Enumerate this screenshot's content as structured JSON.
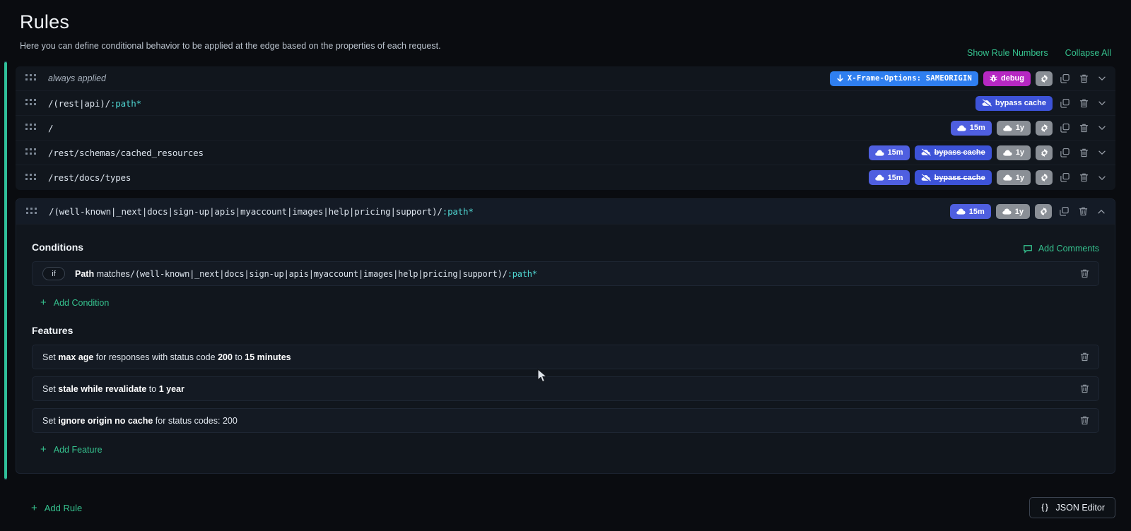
{
  "header": {
    "title": "Rules",
    "subtitle": "Here you can define conditional behavior to be applied at the edge based on the properties of each request."
  },
  "toolbar": {
    "show_rule_numbers": "Show Rule Numbers",
    "collapse_all": "Collapse All"
  },
  "rules": [
    {
      "path_prefix": "always applied",
      "path_suffix": "",
      "is_always": true,
      "badges": [
        {
          "label": "X-Frame-Options: SAMEORIGIN",
          "color": "blue",
          "icon": "arrow-down-icon",
          "mono": true
        },
        {
          "label": "debug",
          "color": "purple",
          "icon": "bug-icon"
        }
      ],
      "has_gear": true
    },
    {
      "path_prefix": "/(rest|api)/",
      "path_suffix": ":path*",
      "is_always": false,
      "badges": [
        {
          "label": "bypass cache",
          "color": "royal",
          "icon": "cloud-slash-icon"
        }
      ],
      "has_gear": false
    },
    {
      "path_prefix": "/",
      "path_suffix": "",
      "is_always": false,
      "badges": [
        {
          "label": "15m",
          "color": "indigo",
          "icon": "cloud-icon"
        },
        {
          "label": "1y",
          "color": "gray",
          "icon": "cloud-icon"
        }
      ],
      "has_gear": true
    },
    {
      "path_prefix": "/rest/schemas/cached_resources",
      "path_suffix": "",
      "is_always": false,
      "badges": [
        {
          "label": "15m",
          "color": "indigo",
          "icon": "cloud-icon"
        },
        {
          "label": "bypass cache",
          "color": "royal",
          "icon": "cloud-slash-icon",
          "strike": true
        },
        {
          "label": "1y",
          "color": "gray",
          "icon": "cloud-icon"
        }
      ],
      "has_gear": true
    },
    {
      "path_prefix": "/rest/docs/types",
      "path_suffix": "",
      "is_always": false,
      "badges": [
        {
          "label": "15m",
          "color": "indigo",
          "icon": "cloud-icon"
        },
        {
          "label": "bypass cache",
          "color": "royal",
          "icon": "cloud-slash-icon",
          "strike": true
        },
        {
          "label": "1y",
          "color": "gray",
          "icon": "cloud-icon"
        }
      ],
      "has_gear": true
    }
  ],
  "expanded_rule": {
    "path_prefix": "/(well-known|_next|docs|sign-up|apis|myaccount|images|help|pricing|support)/",
    "path_suffix": ":path*",
    "badges": [
      {
        "label": "15m",
        "color": "indigo",
        "icon": "cloud-icon"
      },
      {
        "label": "1y",
        "color": "gray",
        "icon": "cloud-icon"
      }
    ],
    "conditions_title": "Conditions",
    "add_comments_label": "Add Comments",
    "conditions": [
      {
        "pill": "if",
        "subject": "Path",
        "operator": "matches",
        "value_prefix": "/(well-known|_next|docs|sign-up|apis|myaccount|images|help|pricing|support)/",
        "value_suffix": ":path*"
      }
    ],
    "add_condition_label": "Add Condition",
    "features_title": "Features",
    "features": [
      {
        "text_html": "Set <b>max age</b> for responses with status code <b>200</b> to <b>15 minutes</b>"
      },
      {
        "text_html": "Set <b>stale while revalidate</b> to <b>1 year</b>"
      },
      {
        "text_html": "Set <b>ignore origin no cache</b> for status codes: 200"
      }
    ],
    "add_feature_label": "Add Feature"
  },
  "footer": {
    "add_rule_label": "Add Rule",
    "json_editor_label": "JSON Editor"
  },
  "colors": {
    "accent_green": "#35c28e",
    "badge_blue": "#2f7ff0",
    "badge_indigo": "#4f5fe0",
    "badge_purple": "#b628c3",
    "badge_gray": "#8a8f96",
    "badge_royal": "#3d53d8",
    "background": "#0a0c10",
    "panel": "#11161d"
  }
}
